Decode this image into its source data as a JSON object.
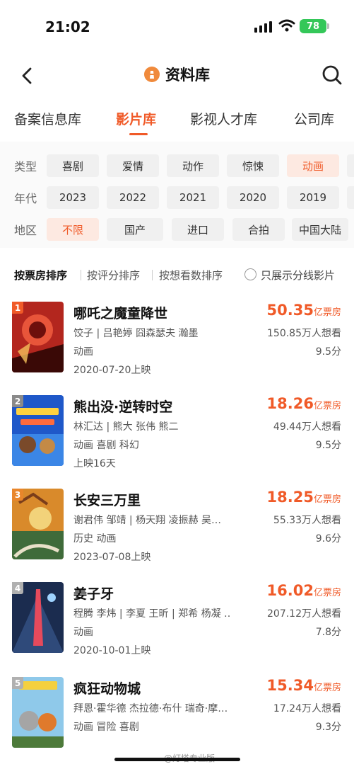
{
  "status": {
    "time": "21:02",
    "battery": "78"
  },
  "nav": {
    "title": "资料库"
  },
  "tabs": [
    {
      "label": "备案信息库"
    },
    {
      "label": "影片库"
    },
    {
      "label": "影视人才库"
    },
    {
      "label": "公司库"
    }
  ],
  "filters": {
    "type_label": "类型",
    "types": [
      "喜剧",
      "爱情",
      "动作",
      "惊悚",
      "动画"
    ],
    "year_label": "年代",
    "years": [
      "2023",
      "2022",
      "2021",
      "2020",
      "2019"
    ],
    "region_label": "地区",
    "regions": [
      "不限",
      "国产",
      "进口",
      "合拍",
      "中国大陆"
    ]
  },
  "sort": {
    "by_box": "按票房排序",
    "by_rating": "按评分排序",
    "by_want": "按想看数排序",
    "only_split": "只展示分线影片"
  },
  "movies": [
    {
      "rank": "1",
      "title": "哪吒之魔童降世",
      "cast": "饺子 | 吕艳婷 囧森瑟夫 瀚墨",
      "genre": "动画",
      "release": "2020-07-20上映",
      "box": "50.35",
      "box_unit": "亿票房",
      "want": "150.85万人想看",
      "score": "9.5分"
    },
    {
      "rank": "2",
      "title": "熊出没·逆转时空",
      "cast": "林汇达 | 熊大 张伟 熊二",
      "genre": "动画 喜剧 科幻",
      "release": "上映16天",
      "box": "18.26",
      "box_unit": "亿票房",
      "want": "49.44万人想看",
      "score": "9.5分"
    },
    {
      "rank": "3",
      "title": "长安三万里",
      "cast": "谢君伟 邹靖 | 杨天翔 凌振赫 吴…",
      "genre": "历史 动画",
      "release": "2023-07-08上映",
      "box": "18.25",
      "box_unit": "亿票房",
      "want": "55.33万人想看",
      "score": "9.6分"
    },
    {
      "rank": "4",
      "title": "姜子牙",
      "cast": "程腾 李炜 | 李夏 王昕 | 郑希 杨凝 …",
      "genre": "动画",
      "release": "2020-10-01上映",
      "box": "16.02",
      "box_unit": "亿票房",
      "want": "207.12万人想看",
      "score": "7.8分"
    },
    {
      "rank": "5",
      "title": "疯狂动物城",
      "cast": "拜恩·霍华德 杰拉德·布什 瑞奇·摩…",
      "genre": "动画 冒险 喜剧",
      "release": "",
      "box": "15.34",
      "box_unit": "亿票房",
      "want": "17.24万人想看",
      "score": "9.3分"
    }
  ],
  "watermark": "@灯塔专业版",
  "colors": {
    "accent": "#f05a28",
    "chip_active_bg": "#fde9e1"
  }
}
